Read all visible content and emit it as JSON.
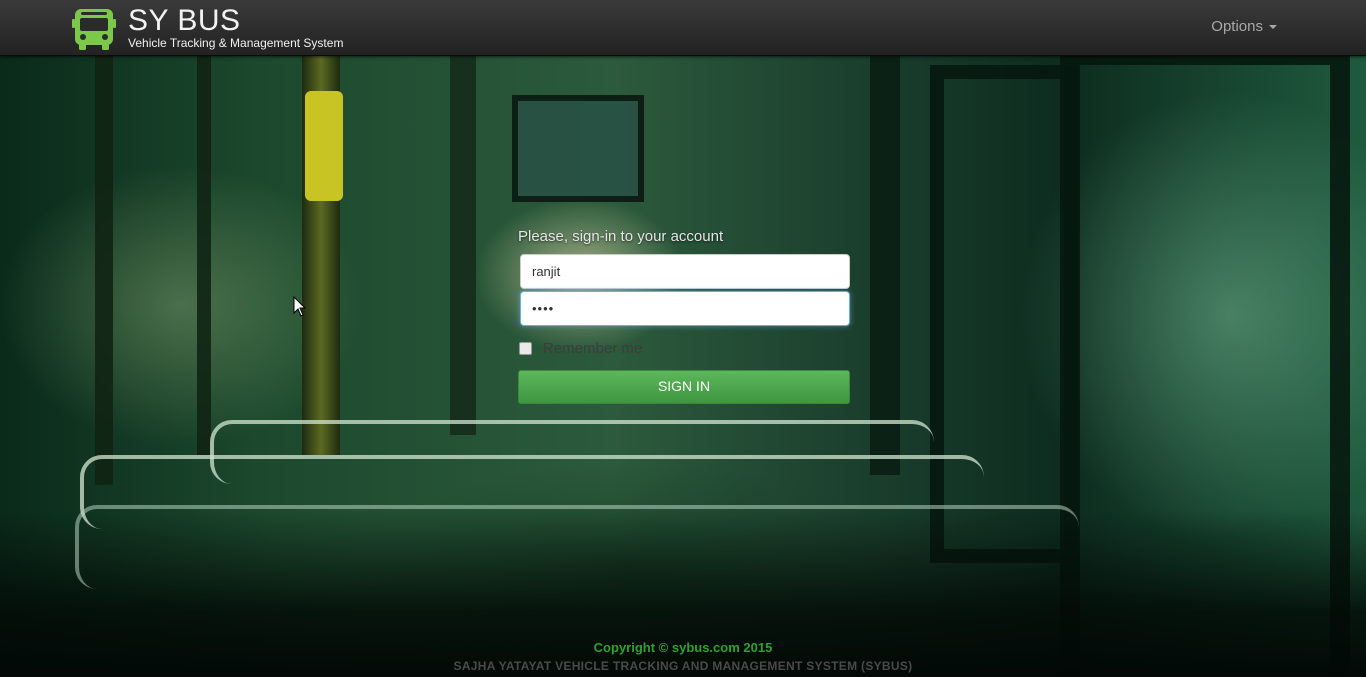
{
  "header": {
    "brand_title": "SY BUS",
    "brand_subtitle": "Vehicle Tracking & Management System",
    "brand_icon": "bus-icon",
    "options_label": "Options"
  },
  "login": {
    "prompt": "Please, sign-in to your account",
    "username_value": "ranjit",
    "password_value": "••••",
    "remember_label": "Remember me",
    "remember_checked": false,
    "signin_label": "SIGN IN"
  },
  "footer": {
    "copyright": "Copyright © sybus.com 2015",
    "system_name": "SAJHA YATAYAT VEHICLE TRACKING AND MANAGEMENT SYSTEM (SYBUS)"
  },
  "colors": {
    "navbar": "#2b2b2b",
    "brand_icon": "#7cc84a",
    "signin_button": "#4cae4c",
    "copyright_text": "#2fa12f"
  }
}
